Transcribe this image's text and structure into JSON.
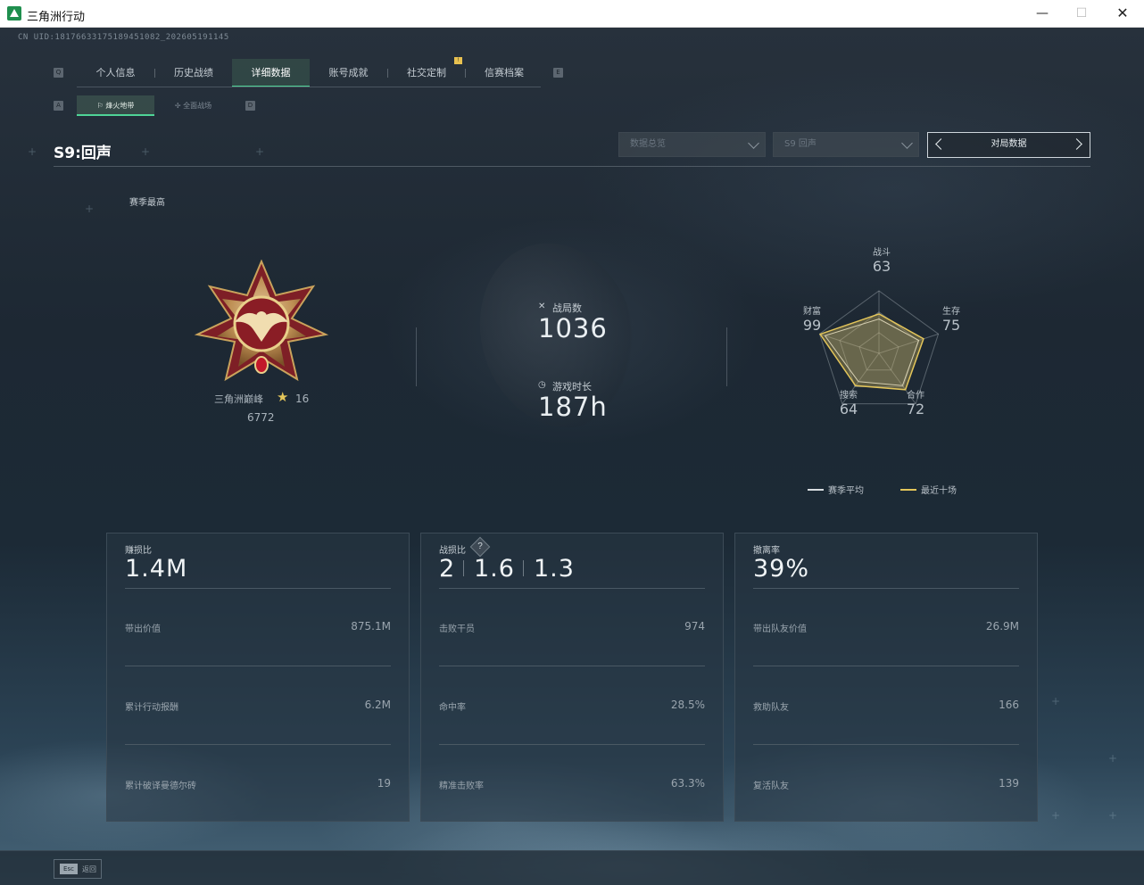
{
  "window": {
    "title": "三角洲行动",
    "minimize": "—",
    "maximize": "☐",
    "close": "✕"
  },
  "uid": "CN UID:18176633175189451082_202605191145",
  "tabs": {
    "items": [
      "个人信息",
      "历史战绩",
      "详细数据",
      "账号成就",
      "社交定制",
      "信赛档案"
    ],
    "active_index": 2,
    "left_key": "Q",
    "right_key": "E",
    "badge": "!"
  },
  "subtabs": {
    "items": [
      "烽火地带",
      "全面战场"
    ],
    "active_index": 0,
    "left_key": "A",
    "right_key": "D"
  },
  "season": {
    "title": "S9:回声"
  },
  "filters": {
    "data_type": "数据总览",
    "season": "S9 回声",
    "pager_label": "对局数据"
  },
  "rank": {
    "section_label": "赛季最高",
    "name": "三角洲巅峰",
    "star_icon": "star-icon",
    "stars": "16",
    "score": "6772"
  },
  "summary": {
    "matches_label": "战局数",
    "matches_value": "1036",
    "time_label": "游戏时长",
    "time_value": "187h"
  },
  "radar": {
    "axes": [
      {
        "label": "战斗",
        "value": "63"
      },
      {
        "label": "生存",
        "value": "75"
      },
      {
        "label": "合作",
        "value": "72"
      },
      {
        "label": "搜索",
        "value": "64"
      },
      {
        "label": "财富",
        "value": "99"
      }
    ],
    "series": [
      {
        "name": "赛季平均",
        "color": "#d8dde0"
      },
      {
        "name": "最近十场",
        "color": "#e3c55a"
      }
    ]
  },
  "panels": [
    {
      "head_label": "赚损比",
      "head_value": "1.4M",
      "rows": [
        {
          "label": "带出价值",
          "value": "875.1M"
        },
        {
          "label": "累计行动报酬",
          "value": "6.2M"
        },
        {
          "label": "累计破译曼德尔砖",
          "value": "19"
        }
      ]
    },
    {
      "head_label": "战损比",
      "head_values": [
        "2",
        "1.6",
        "1.3"
      ],
      "help": "?",
      "rows": [
        {
          "label": "击败干员",
          "value": "974"
        },
        {
          "label": "命中率",
          "value": "28.5%"
        },
        {
          "label": "精准击败率",
          "value": "63.3%"
        }
      ]
    },
    {
      "head_label": "撤离率",
      "head_value": "39%",
      "rows": [
        {
          "label": "带出队友价值",
          "value": "26.9M"
        },
        {
          "label": "救助队友",
          "value": "166"
        },
        {
          "label": "复活队友",
          "value": "139"
        }
      ]
    }
  ],
  "footer": {
    "esc_key": "Esc",
    "esc_label": "返回"
  }
}
